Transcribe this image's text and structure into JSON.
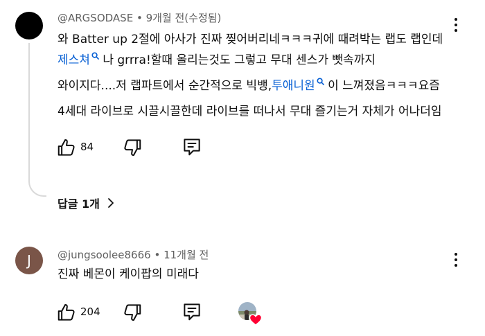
{
  "comments": [
    {
      "author": "@ARGSODASE",
      "time": "9개월 전(수정됨)",
      "lines": {
        "l1": "와 Batter up 2절에 아사가 진짜 찢어버리네ㅋㅋㅋ귀에 때려박는 랩도 랩인데",
        "l2_link": "제스쳐",
        "l2_rest": " 나 grrra!할때 올리는것도 그렇고 무대 센스가 뺏속까지",
        "l3_pre": "와이지다....저 랩파트에서 순간적으로 빅뱅,",
        "l3_link": "투애니원",
        "l3_post": " 이 느껴졌음ㅋㅋㅋ요즘",
        "l4": "4세대 라이브로 시끌시끌한데 라이브를 떠나서 무대 즐기는거 자체가 어나더임"
      },
      "likes": "84",
      "replies_label": "답글 1개"
    },
    {
      "author": "@jungsoolee8666",
      "avatar_letter": "J",
      "time": "11개월 전",
      "text": "진짜 베몬이 케이팝의 미래다",
      "likes": "204"
    }
  ],
  "separator": " • ",
  "colors": {
    "link": "#065fd4",
    "meta": "#606060",
    "heart": "#ff0033",
    "avatar_j": "#7a5548"
  },
  "icons": [
    "more-vert-icon",
    "thumb-up-icon",
    "thumb-down-icon",
    "reply-icon",
    "search-icon",
    "chevron-right-icon",
    "heart-icon"
  ]
}
